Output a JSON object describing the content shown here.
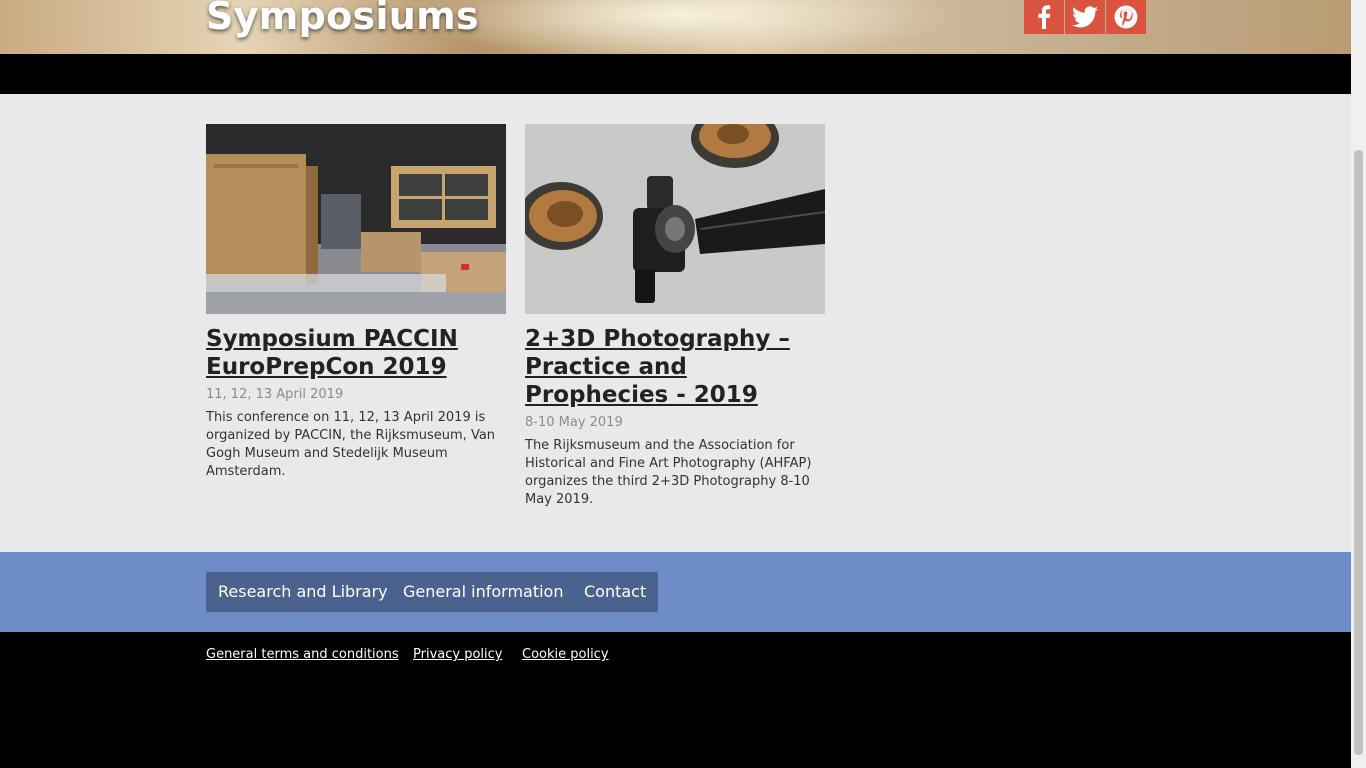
{
  "hero": {
    "title": "Symposiums"
  },
  "social": [
    {
      "icon": "facebook-icon"
    },
    {
      "icon": "twitter-icon"
    },
    {
      "icon": "pinterest-icon"
    }
  ],
  "cards": [
    {
      "title": "Symposium PACCIN EuroPrepCon 2019",
      "date": "11, 12, 13 April 2019",
      "text": "This conference on 11, 12, 13 April 2019 is organized by PACCIN, the Rijksmuseum, Van Gogh Museum and Stedelijk Museum Amsterdam."
    },
    {
      "title": "2+3D Photography – Practice and Prophecies - 2019",
      "date": "8-10 May 2019",
      "text": "The Rijksmuseum and the Association for Historical and Fine Art Photography (AHFAP) organizes the third 2+3D Photography 8-10 May 2019."
    }
  ],
  "nav": [
    "Research and Library",
    "General information",
    "Contact"
  ],
  "footer": [
    "General terms and conditions ",
    "Privacy policy ",
    "Cookie policy"
  ],
  "colors": {
    "social": "#d9533e",
    "nav_bar": "#6d8cc7",
    "nav_button": "#4a628d",
    "footer": "#000000",
    "page": "#e9e9e9"
  }
}
